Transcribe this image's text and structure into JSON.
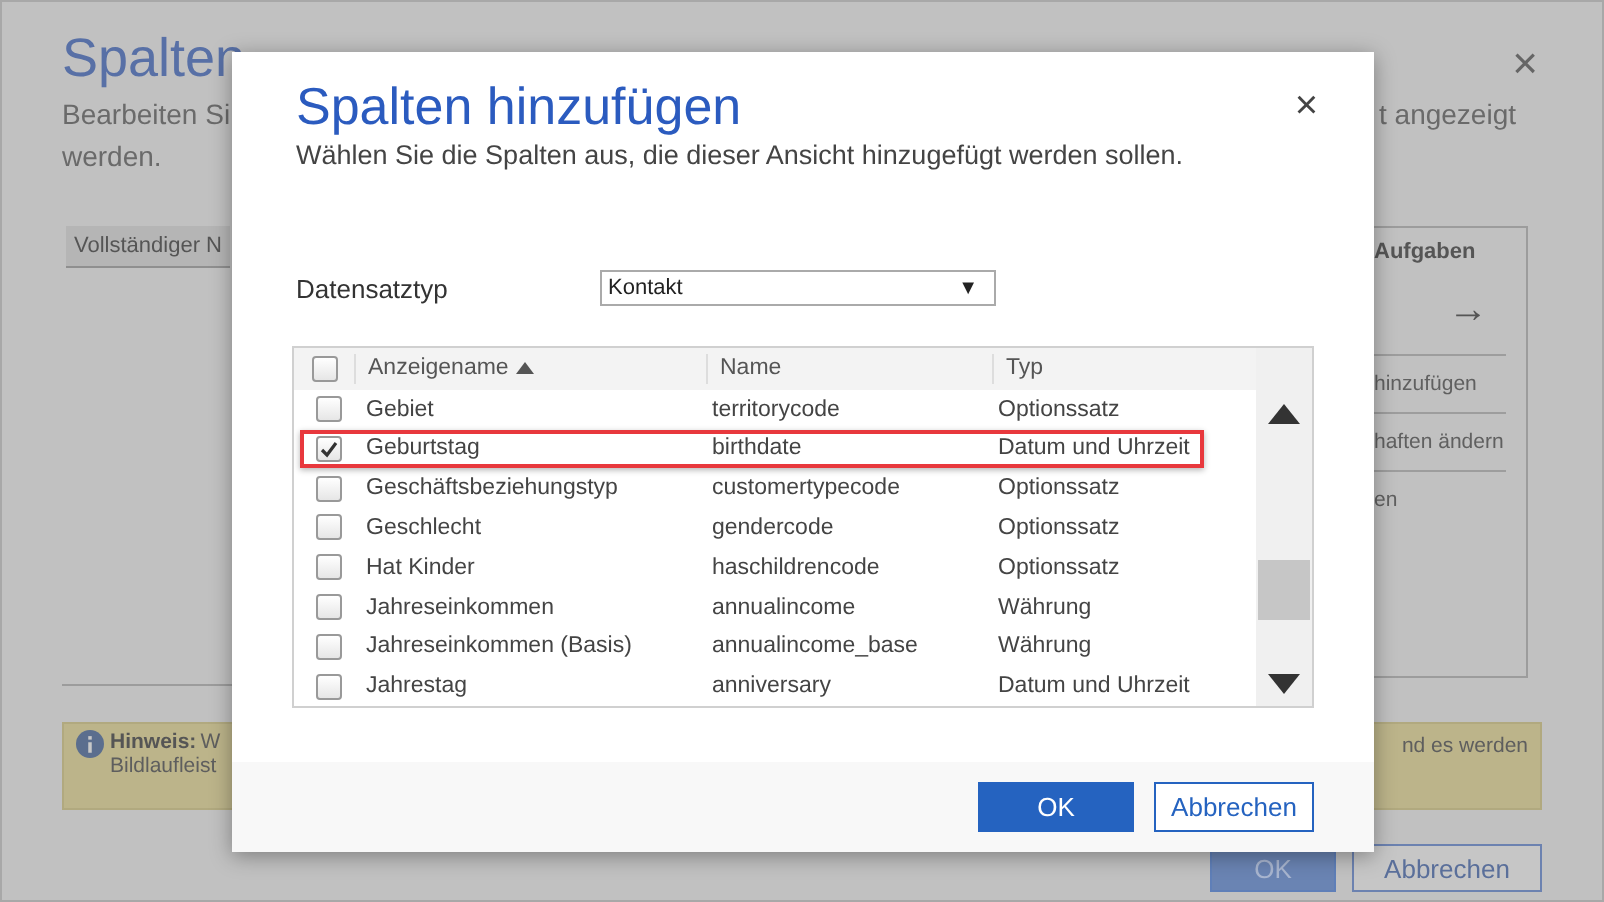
{
  "background_page": {
    "title": "Spalten",
    "description_left": [
      "Bearbeiten Si",
      "werden."
    ],
    "description_right": "t angezeigt",
    "column_chip": "Vollständiger N",
    "tasks_panel": {
      "heading": "Aufgaben",
      "arrow": "→",
      "items": [
        "hinzufügen",
        "haften ändern",
        "en"
      ]
    },
    "notice": {
      "label": "Hinweis:",
      "text_left": "W",
      "text_left_line2": "Bildlaufleist",
      "text_right": "nd es werden"
    },
    "buttons": [
      {
        "label": "OK",
        "kind": "primary"
      },
      {
        "label": "Abbrechen",
        "kind": "secondary"
      }
    ],
    "close": "×"
  },
  "dialog": {
    "title": "Spalten hinzufügen",
    "subtitle": "Wählen Sie die Spalten aus, die dieser Ansicht hinzugefügt werden sollen.",
    "close": "×",
    "record_type": {
      "label": "Datensatztyp",
      "value": "Kontakt",
      "arrow": "▼"
    },
    "table": {
      "select_all_checked": false,
      "columns": [
        {
          "label": "Anzeigename",
          "sorted": true
        },
        {
          "label": "Name",
          "sorted": false
        },
        {
          "label": "Typ",
          "sorted": false
        }
      ],
      "rows": [
        {
          "display_name": "Gebiet",
          "name": "territorycode",
          "type": "Optionssatz",
          "checked": false,
          "highlighted": false
        },
        {
          "display_name": "Geburtstag",
          "name": "birthdate",
          "type": "Datum und Uhrzeit",
          "checked": true,
          "highlighted": true
        },
        {
          "display_name": "Geschäftsbeziehungstyp",
          "name": "customertypecode",
          "type": "Optionssatz",
          "checked": false,
          "highlighted": false
        },
        {
          "display_name": "Geschlecht",
          "name": "gendercode",
          "type": "Optionssatz",
          "checked": false,
          "highlighted": false
        },
        {
          "display_name": "Hat Kinder",
          "name": "haschildrencode",
          "type": "Optionssatz",
          "checked": false,
          "highlighted": false
        },
        {
          "display_name": "Jahreseinkommen",
          "name": "annualincome",
          "type": "Währung",
          "checked": false,
          "highlighted": false
        },
        {
          "display_name": "Jahreseinkommen (Basis)",
          "name": "annualincome_base",
          "type": "Währung",
          "checked": false,
          "highlighted": false
        },
        {
          "display_name": "Jahrestag",
          "name": "anniversary",
          "type": "Datum und Uhrzeit",
          "checked": false,
          "highlighted": false
        }
      ]
    },
    "buttons": [
      {
        "label": "OK",
        "kind": "primary"
      },
      {
        "label": "Abbrechen",
        "kind": "secondary"
      }
    ]
  }
}
